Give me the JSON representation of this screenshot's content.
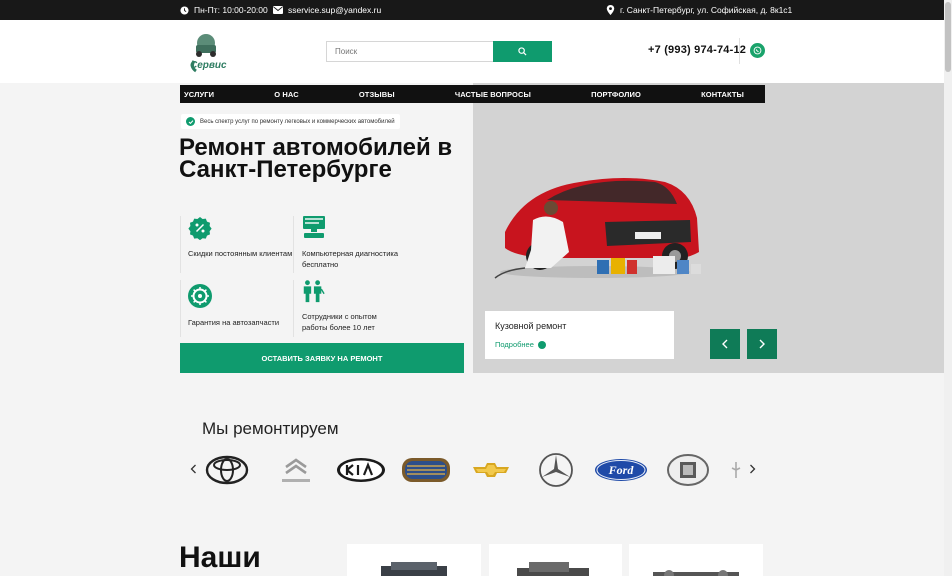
{
  "topbar": {
    "hours": "Пн-Пт: 10:00-20:00",
    "email": "sservice.sup@yandex.ru",
    "address": "г. Санкт-Петербург, ул. Софийская, д. 8к1с1"
  },
  "header": {
    "logo_text": "Сервис",
    "search_placeholder": "Поиск",
    "phone": "+7 (993) 974-74-12"
  },
  "nav": [
    "УСЛУГИ",
    "О НАС",
    "ОТЗЫВЫ",
    "ЧАСТЫЕ ВОПРОСЫ",
    "ПОРТФОЛИО",
    "КОНТАКТЫ"
  ],
  "hero": {
    "badge": "Весь спектр услуг по ремонту легковых и коммерческих автомобилей",
    "title": "Ремонт автомобилей в Санкт-Петербурге",
    "features": [
      "Скидки постоянным клиентам",
      "Компьютерная диагностика бесплатно",
      "Гарантия на автозапчасти",
      "Сотрудники с опытом работы более 10 лет"
    ],
    "cta": "ОСТАВИТЬ ЗАЯВКУ НА РЕМОНТ",
    "slide_title": "Кузовной ремонт",
    "slide_more": "Подробнее"
  },
  "brands": {
    "title": "Мы ремонтируем",
    "items": [
      "Toyota",
      "Citroën",
      "KIA",
      "Geely",
      "Chevrolet",
      "Mercedes-Benz",
      "Ford",
      "Haval",
      "Changan"
    ]
  },
  "bottom": {
    "title": "Наши"
  },
  "colors": {
    "accent": "#0f9b6e",
    "dark": "#181818"
  }
}
